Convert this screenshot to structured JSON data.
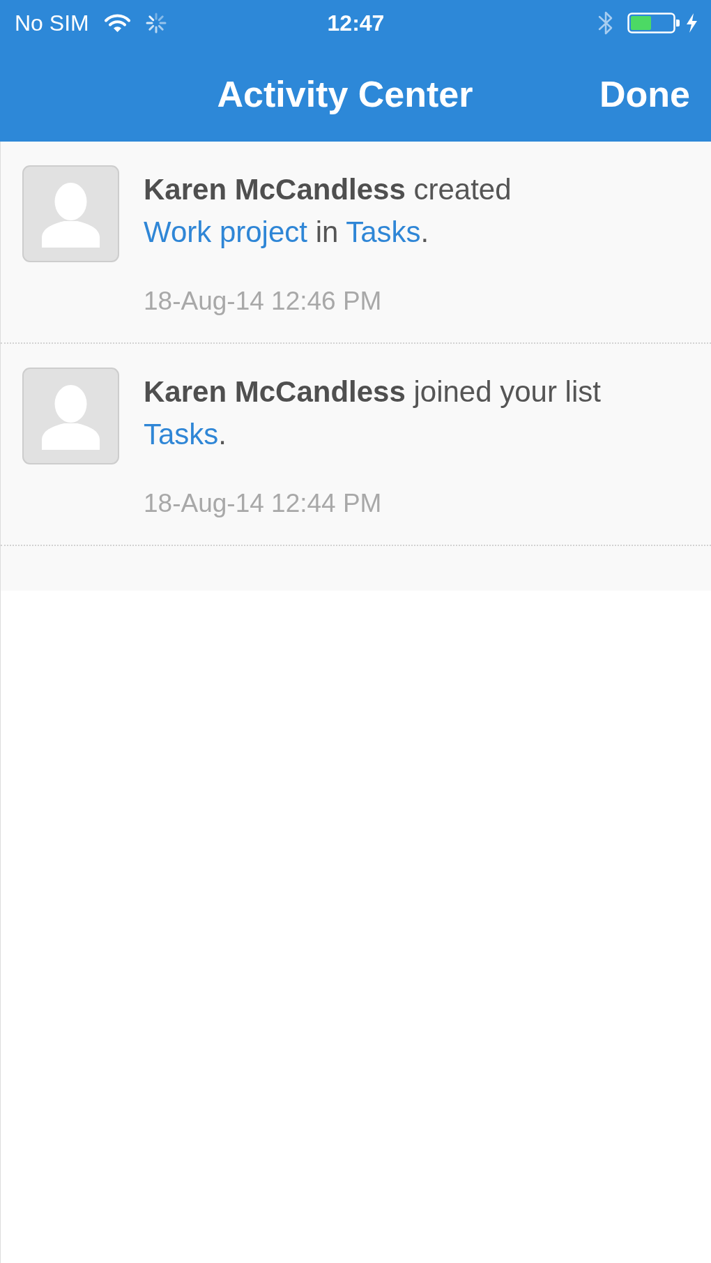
{
  "status_bar": {
    "carrier": "No SIM",
    "time": "12:47"
  },
  "nav_bar": {
    "title": "Activity Center",
    "done_button": "Done"
  },
  "activities": [
    {
      "message": [
        {
          "kind": "name",
          "text": "Karen McCandless"
        },
        {
          "kind": "text",
          "text": " created "
        },
        {
          "kind": "link",
          "text": "Work project"
        },
        {
          "kind": "text",
          "text": " in "
        },
        {
          "kind": "link",
          "text": "Tasks"
        },
        {
          "kind": "text",
          "text": "."
        }
      ],
      "timestamp": "18-Aug-14 12:46 PM"
    },
    {
      "message": [
        {
          "kind": "name",
          "text": "Karen McCandless"
        },
        {
          "kind": "text",
          "text": " joined your list "
        },
        {
          "kind": "link",
          "text": "Tasks"
        },
        {
          "kind": "text",
          "text": "."
        }
      ],
      "timestamp": "18-Aug-14 12:44 PM"
    }
  ]
}
